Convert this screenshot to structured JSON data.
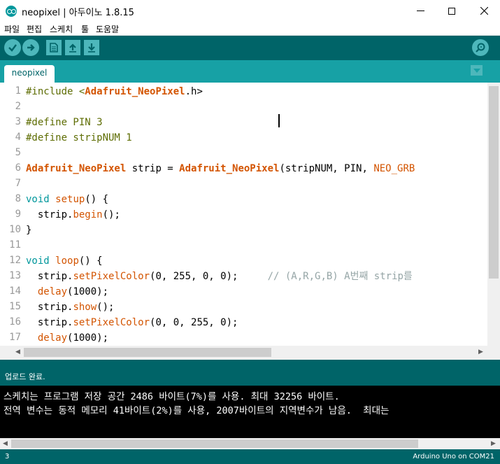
{
  "window": {
    "title": "neopixel | 아두이노 1.8.15"
  },
  "menu": {
    "items": [
      "파일",
      "편집",
      "스케치",
      "툴",
      "도움말"
    ]
  },
  "toolbar": {
    "icons": [
      "verify-icon",
      "upload-icon",
      "new-icon",
      "open-icon",
      "save-icon",
      "serial-monitor-icon"
    ]
  },
  "tabs": {
    "active": "neopixel"
  },
  "editor": {
    "line_numbers": [
      "1",
      "2",
      "3",
      "4",
      "5",
      "6",
      "7",
      "8",
      "9",
      "10",
      "11",
      "12",
      "13",
      "14",
      "15",
      "16",
      "17"
    ],
    "lines": [
      [
        {
          "t": "#include <",
          "c": "kw-pre"
        },
        {
          "t": "Adafruit_NeoPixel",
          "c": "kw-lib"
        },
        {
          "t": ".h>",
          "c": ""
        }
      ],
      [],
      [
        {
          "t": "#define PIN 3",
          "c": "kw-pre"
        }
      ],
      [
        {
          "t": "#define stripNUM 1",
          "c": "kw-pre"
        }
      ],
      [],
      [
        {
          "t": "Adafruit_NeoPixel",
          "c": "kw-lib"
        },
        {
          "t": " strip = ",
          "c": ""
        },
        {
          "t": "Adafruit_NeoPixel",
          "c": "kw-lib"
        },
        {
          "t": "(stripNUM, PIN, ",
          "c": ""
        },
        {
          "t": "NEO_GRB",
          "c": "kw-fn"
        }
      ],
      [],
      [
        {
          "t": "void",
          "c": "kw-type"
        },
        {
          "t": " ",
          "c": ""
        },
        {
          "t": "setup",
          "c": "kw-fn"
        },
        {
          "t": "() {",
          "c": ""
        }
      ],
      [
        {
          "t": "  strip.",
          "c": ""
        },
        {
          "t": "begin",
          "c": "kw-fn"
        },
        {
          "t": "();",
          "c": ""
        }
      ],
      [
        {
          "t": "}",
          "c": ""
        }
      ],
      [],
      [
        {
          "t": "void",
          "c": "kw-type"
        },
        {
          "t": " ",
          "c": ""
        },
        {
          "t": "loop",
          "c": "kw-fn"
        },
        {
          "t": "() {",
          "c": ""
        }
      ],
      [
        {
          "t": "  strip.",
          "c": ""
        },
        {
          "t": "setPixelColor",
          "c": "kw-fn"
        },
        {
          "t": "(0, 255, 0, 0);     ",
          "c": ""
        },
        {
          "t": "// (A,R,G,B) A번째 strip를",
          "c": "kw-comment"
        }
      ],
      [
        {
          "t": "  ",
          "c": ""
        },
        {
          "t": "delay",
          "c": "kw-fn"
        },
        {
          "t": "(1000);",
          "c": ""
        }
      ],
      [
        {
          "t": "  strip.",
          "c": ""
        },
        {
          "t": "show",
          "c": "kw-fn"
        },
        {
          "t": "();",
          "c": ""
        }
      ],
      [
        {
          "t": "  strip.",
          "c": ""
        },
        {
          "t": "setPixelColor",
          "c": "kw-fn"
        },
        {
          "t": "(0, 0, 255, 0);",
          "c": ""
        }
      ],
      [
        {
          "t": "  ",
          "c": ""
        },
        {
          "t": "delay",
          "c": "kw-fn"
        },
        {
          "t": "(1000);",
          "c": ""
        }
      ]
    ]
  },
  "status": {
    "upload_message": "업로드 완료."
  },
  "console": {
    "lines": [
      "스케치는 프로그램 저장 공간 2486 바이트(7%)를 사용. 최대 32256 바이트.",
      "전역 변수는 동적 메모리 41바이트(2%)를 사용, 2007바이트의 지역변수가 남음.  최대는"
    ]
  },
  "bottombar": {
    "line": "3",
    "board": "Arduino Uno on COM21"
  },
  "colors": {
    "toolbar": "#006468",
    "tabbar": "#17a1a5",
    "accent": "#4db7bb"
  }
}
